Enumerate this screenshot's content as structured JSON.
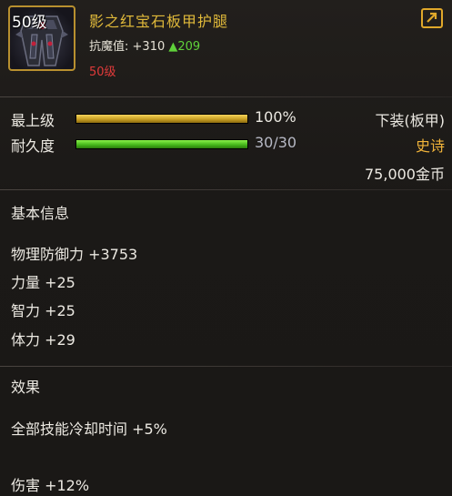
{
  "header": {
    "level_badge": "50级",
    "item_name": "影之红宝石板甲护腿",
    "stat_label": "抗魔值:",
    "stat_value": "+310",
    "stat_up_arrow": "▲",
    "stat_up_value": "209",
    "required_level": "50级",
    "share_icon": "share-out-icon",
    "item_icon": "dark-armor-leggings-icon"
  },
  "bars": {
    "level_label": "最上级",
    "level_percent": 100,
    "level_value": "100%",
    "durability_label": "耐久度",
    "durability_current": 30,
    "durability_max": 30,
    "durability_value": "30/30"
  },
  "item_meta": {
    "slot": "下装(板甲)",
    "rarity": "史诗",
    "price": "75,000金币"
  },
  "basic_info": {
    "title": "基本信息",
    "attributes": [
      "物理防御力 +3753",
      "力量 +25",
      "智力 +25",
      "体力 +29"
    ]
  },
  "effects": {
    "title": "效果",
    "lines": [
      "全部技能冷却时间 +5%",
      "伤害 +12%"
    ]
  },
  "colors": {
    "name": "#e0b93a",
    "rarity_epic": "#f2b43a",
    "required_level": "#e03a3a",
    "stat_up": "#5fd13a",
    "level_bar": "#c9a024",
    "durability_bar": "#47b81c"
  }
}
